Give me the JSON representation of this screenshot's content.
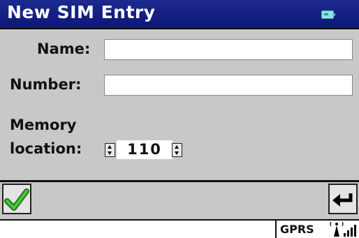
{
  "titlebar": {
    "title": "New SIM Entry",
    "battery_icon": "battery-icon"
  },
  "form": {
    "name_label": "Name:",
    "name_value": "",
    "number_label": "Number:",
    "number_value": "",
    "memory_label_line1": "Memory",
    "memory_label_line2": "location:",
    "memory_value": "110"
  },
  "commandbar": {
    "ok_icon": "checkmark-icon",
    "back_icon": "back-arrow-icon"
  },
  "statusbar": {
    "network": "GPRS",
    "signal_icon": "signal-strength-icon"
  },
  "colors": {
    "titlebar": "#0c1878",
    "background": "#c8c8c8",
    "check": "#2fa52a"
  }
}
